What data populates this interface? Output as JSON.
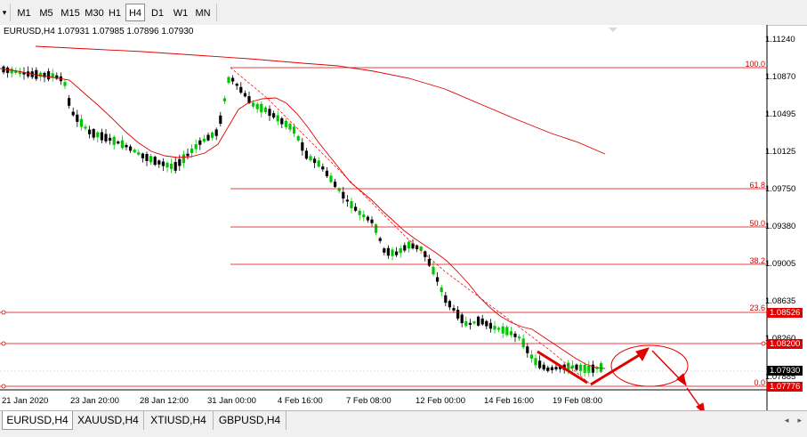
{
  "toolbar": {
    "dropdown_icon": "triangle-down-icon",
    "timeframes": [
      "M1",
      "M5",
      "M15",
      "M30",
      "H1",
      "H4",
      "D1",
      "W1",
      "MN"
    ],
    "active": "H4"
  },
  "chart": {
    "header": "EURUSD,H4  1.07931 1.07985 1.07896 1.07930",
    "price_axis": [
      "1.11240",
      "1.10870",
      "1.10495",
      "1.10125",
      "1.09750",
      "1.09380",
      "1.09005",
      "1.08635",
      "1.08260",
      "1.07885"
    ],
    "time_axis": [
      "21 Jan 2020",
      "23 Jan 20:00",
      "28 Jan 12:00",
      "31 Jan 00:00",
      "4 Feb 16:00",
      "7 Feb 08:00",
      "12 Feb 00:00",
      "14 Feb 16:00",
      "19 Feb 08:00"
    ],
    "fib_levels": [
      "100.0",
      "61.8",
      "50.0",
      "38.2",
      "23.6",
      "0.0"
    ],
    "price_boxes": {
      "level1": "1.08526",
      "level2": "1.08200",
      "current": "1.07930",
      "level3": "1.07776"
    },
    "colors": {
      "bull": "#00c800",
      "bear": "#000000",
      "ma": "#e00000",
      "line": "#e00000",
      "arrow": "#e00000"
    }
  },
  "tabs": {
    "items": [
      "EURUSD,H4",
      "XAUUSD,H4",
      "XTIUSD,H4",
      "GBPUSD,H4"
    ],
    "active": "EURUSD,H4",
    "scroll_left_icon": "arrow-left-icon",
    "scroll_right_icon": "arrow-right-icon"
  }
}
